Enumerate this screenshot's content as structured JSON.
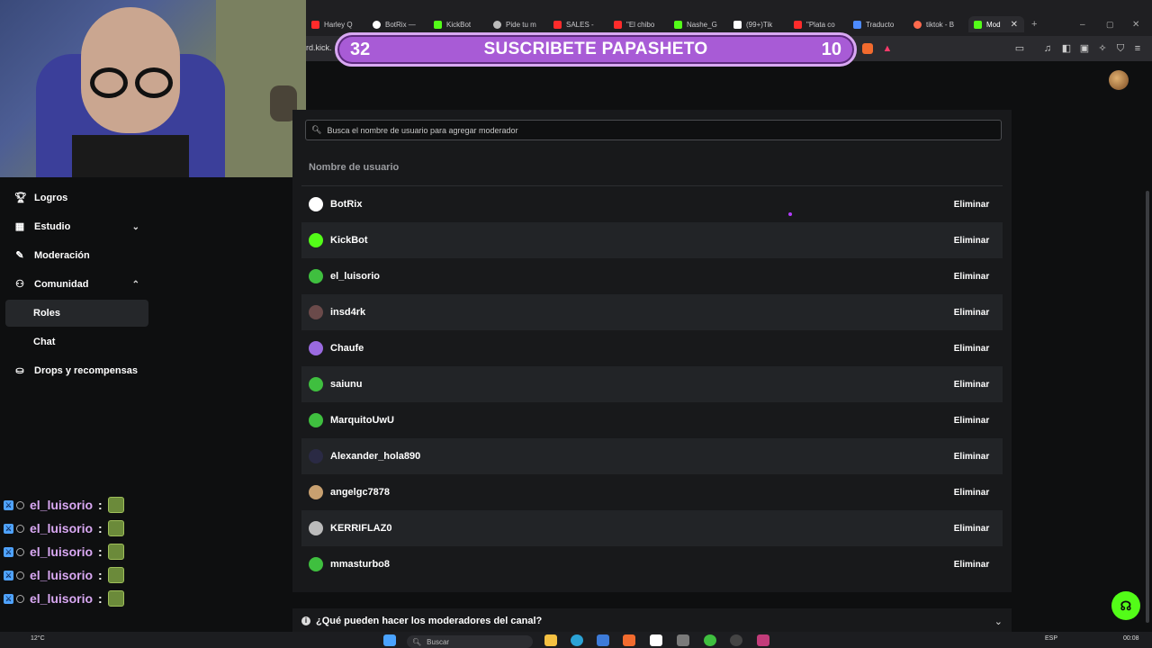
{
  "browser": {
    "tabs": [
      {
        "label": "Harley Q",
        "color": "#ff2b2b"
      },
      {
        "label": "BotRix —",
        "color": "#ffffff"
      },
      {
        "label": "KickBot",
        "color": "#53fc18"
      },
      {
        "label": "Pide tu m",
        "color": "#bbbbbb"
      },
      {
        "label": "SALES -",
        "color": "#ff2b2b"
      },
      {
        "label": "\"El chibo",
        "color": "#ff2b2b"
      },
      {
        "label": "Nashe_G",
        "color": "#53fc18"
      },
      {
        "label": "(99+)Tik",
        "color": "#ffffff"
      },
      {
        "label": "\"Plata co",
        "color": "#ff2b2b"
      },
      {
        "label": "Traducto",
        "color": "#4d8bff"
      },
      {
        "label": "tiktok - B",
        "color": "#ff6a4d"
      },
      {
        "label": "Mod",
        "color": "#53fc18"
      }
    ],
    "url_fragment": "rd.kick."
  },
  "banner": {
    "left_number": "32",
    "text": "SUSCRIBETE PAPASHETO",
    "right_number": "10"
  },
  "sidebar": {
    "items": [
      {
        "label": "Logros",
        "icon": "trophy-icon"
      },
      {
        "label": "Estudio",
        "icon": "studio-icon"
      },
      {
        "label": "Moderación",
        "icon": "wrench-icon"
      },
      {
        "label": "Comunidad",
        "icon": "community-icon"
      },
      {
        "label": "Roles"
      },
      {
        "label": "Chat"
      },
      {
        "label": "Drops y recompensas",
        "icon": "gift-icon"
      }
    ]
  },
  "chat_overlay": [
    {
      "user": "el_luisorio",
      "sep": ":"
    },
    {
      "user": "el_luisorio",
      "sep": ":"
    },
    {
      "user": "el_luisorio",
      "sep": ":"
    },
    {
      "user": "el_luisorio",
      "sep": ":"
    },
    {
      "user": "el_luisorio",
      "sep": ":"
    }
  ],
  "moderators": {
    "search_placeholder": "Busca el nombre de usuario para agregar moderador",
    "column_header": "Nombre de usuario",
    "remove_label": "Eliminar",
    "rows": [
      {
        "name": "BotRix",
        "avatar_color": "#ffffff"
      },
      {
        "name": "KickBot",
        "avatar_color": "#53fc18"
      },
      {
        "name": "el_luisorio",
        "avatar_color": "#3fbf3f"
      },
      {
        "name": "insd4rk",
        "avatar_color": "#6a4a4a"
      },
      {
        "name": "Chaufe",
        "avatar_color": "#9a6ae0"
      },
      {
        "name": "saiunu",
        "avatar_color": "#3fbf3f"
      },
      {
        "name": "MarquitoUwU",
        "avatar_color": "#3fbf3f"
      },
      {
        "name": "Alexander_hola890",
        "avatar_color": "#2a2a44"
      },
      {
        "name": "angelgc7878",
        "avatar_color": "#c8a070"
      },
      {
        "name": "KERRIFLAZ0",
        "avatar_color": "#bbbbbb"
      },
      {
        "name": "mmasturbo8",
        "avatar_color": "#3fbf3f"
      }
    ]
  },
  "faq": {
    "question": "¿Qué pueden hacer los moderadores del canal?"
  },
  "taskbar": {
    "weather": "12°C",
    "search_placeholder": "Buscar",
    "lang": "ESP",
    "time": "00:08"
  },
  "colors": {
    "accent": "#53fc18",
    "banner_purple": "#a85bd6",
    "panel_bg": "#18191b"
  }
}
